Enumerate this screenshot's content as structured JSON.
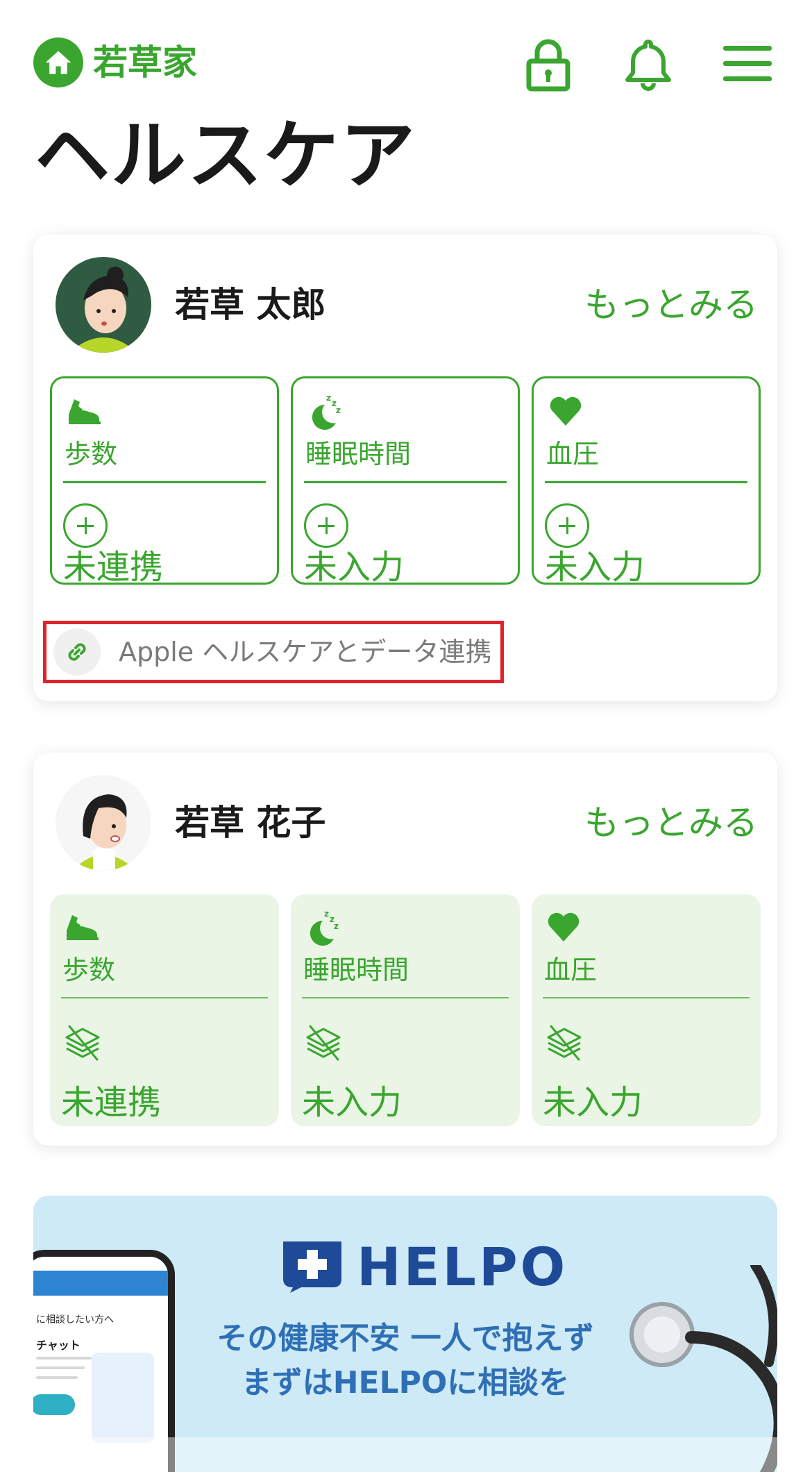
{
  "header": {
    "family_name": "若草家",
    "icons": [
      "home-icon",
      "lock-icon",
      "bell-icon",
      "menu-icon"
    ]
  },
  "page_title": "ヘルスケア",
  "members": [
    {
      "name": "若草 太郎",
      "more_label": "もっとみる",
      "tiles": [
        {
          "icon": "shoe-icon",
          "label": "歩数",
          "status": "未連携"
        },
        {
          "icon": "sleep-icon",
          "label": "睡眠時間",
          "status": "未入力"
        },
        {
          "icon": "heart-icon",
          "label": "血圧",
          "status": "未入力"
        }
      ],
      "apple_link_label": "Apple ヘルスケアとデータ連携"
    },
    {
      "name": "若草 花子",
      "more_label": "もっとみる",
      "tiles": [
        {
          "icon": "shoe-icon",
          "label": "歩数",
          "status": "未連携"
        },
        {
          "icon": "sleep-icon",
          "label": "睡眠時間",
          "status": "未入力"
        },
        {
          "icon": "heart-icon",
          "label": "血圧",
          "status": "未入力"
        }
      ]
    }
  ],
  "banner": {
    "brand": "HELPO",
    "line1": "その健康不安 一人で抱えず",
    "line2": "まずはHELPOに相談を",
    "phone_text1": "に相談したい方へ",
    "phone_text2": "チャット"
  },
  "colors": {
    "accent": "#3aa62f",
    "tile_bg_inactive": "#eaf5e6",
    "highlight_border": "#e0222a",
    "banner_bg": "#cdeaf6",
    "helpo_blue": "#1f4a98"
  }
}
